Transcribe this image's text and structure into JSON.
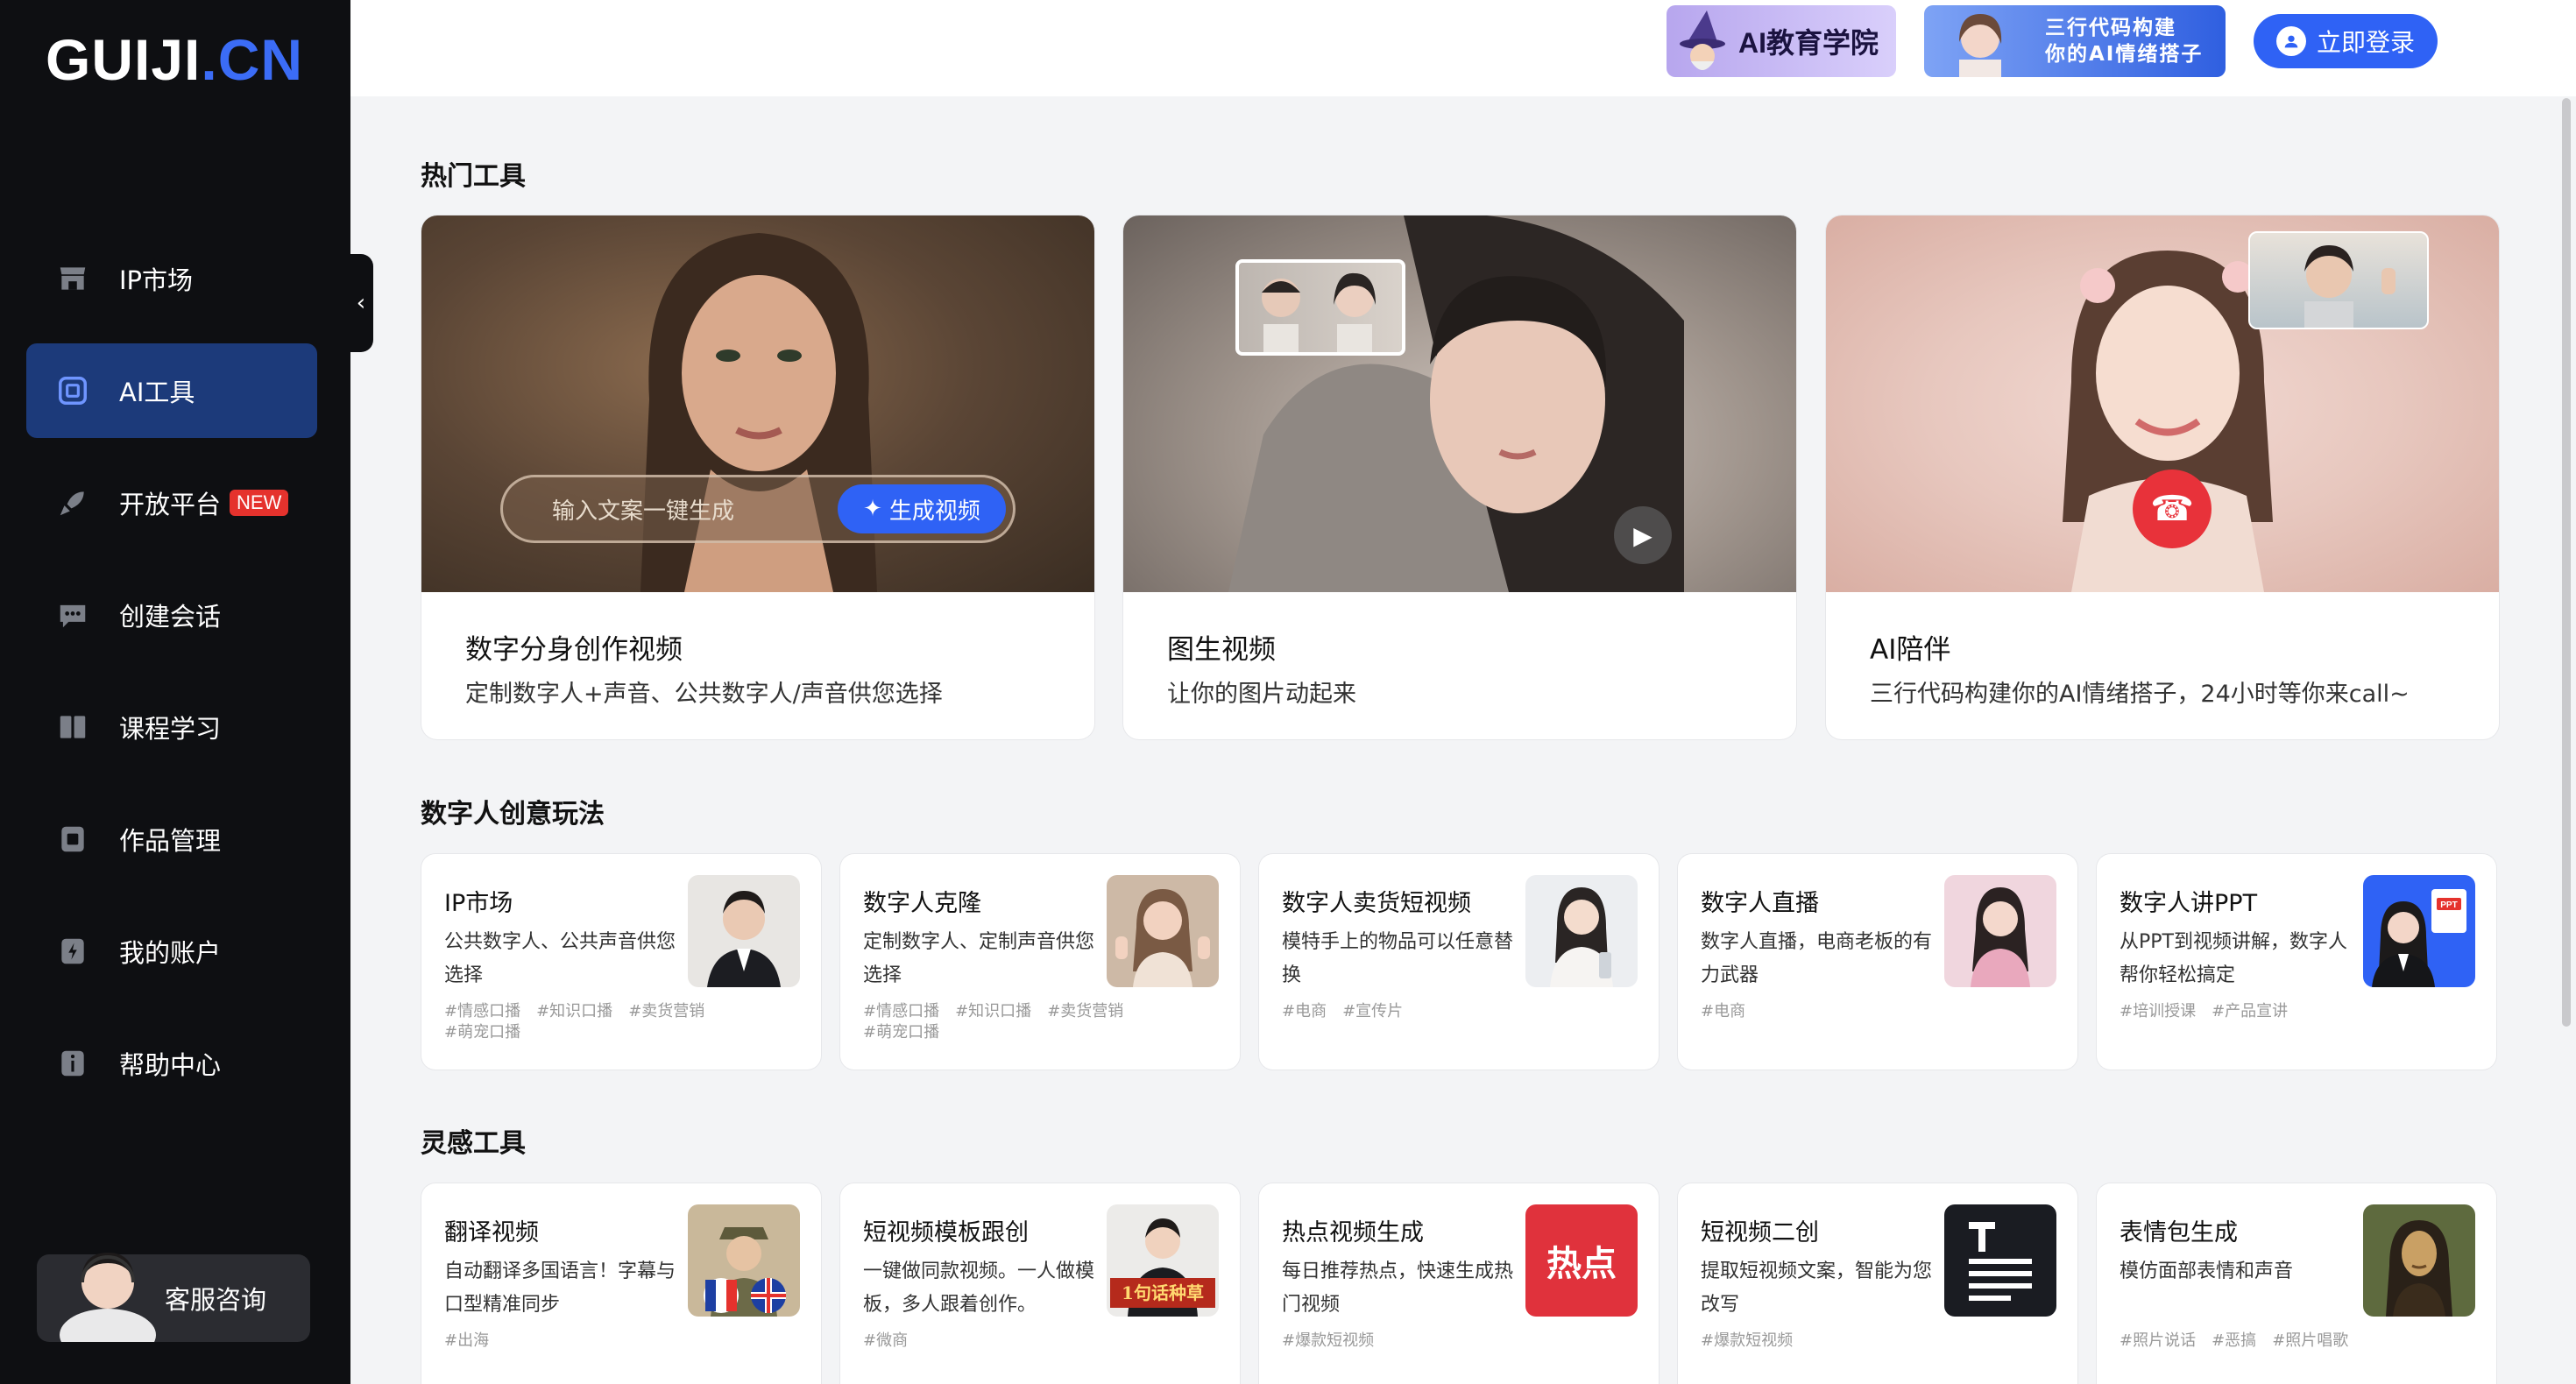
{
  "logo": {
    "main": "GUIJI",
    "dot_cn": ".CN"
  },
  "sidebar": {
    "items": [
      {
        "label": "IP市场",
        "icon": "store-icon"
      },
      {
        "label": "AI工具",
        "icon": "ai-tools-icon",
        "active": true
      },
      {
        "label": "开放平台",
        "icon": "rocket-icon",
        "badge": "NEW"
      },
      {
        "label": "创建会话",
        "icon": "chat-icon"
      },
      {
        "label": "课程学习",
        "icon": "course-icon"
      },
      {
        "label": "作品管理",
        "icon": "works-icon"
      },
      {
        "label": "我的账户",
        "icon": "account-icon"
      },
      {
        "label": "帮助中心",
        "icon": "help-icon"
      }
    ],
    "support_label": "客服咨询",
    "collapse_glyph": "‹"
  },
  "header": {
    "promo1": "AI教育学院",
    "promo2_line1": "三行代码构建",
    "promo2_line2": "你的AI情绪搭子",
    "login_label": "立即登录"
  },
  "sections": {
    "hot_tools": "热门工具",
    "digital_human": "数字人创意玩法",
    "inspiration": "灵感工具"
  },
  "hot_cards": [
    {
      "title": "数字分身创作视频",
      "desc": "定制数字人+声音、公共数字人/声音供您选择",
      "input_placeholder": "输入文案一键生成",
      "button": "生成视频"
    },
    {
      "title": "图生视频",
      "desc": "让你的图片动起来"
    },
    {
      "title": "AI陪伴",
      "desc": "三行代码构建你的AI情绪搭子，24小时等你来call~"
    }
  ],
  "digital_cards": [
    {
      "title": "IP市场",
      "desc": "公共数字人、公共声音供您选择",
      "tags": [
        "#情感口播",
        "#知识口播",
        "#卖货营销",
        "#萌宠口播"
      ]
    },
    {
      "title": "数字人克隆",
      "desc": "定制数字人、定制声音供您选择",
      "tags": [
        "#情感口播",
        "#知识口播",
        "#卖货营销",
        "#萌宠口播"
      ]
    },
    {
      "title": "数字人卖货短视频",
      "desc": "模特手上的物品可以任意替换",
      "tags": [
        "#电商",
        "#宣传片"
      ]
    },
    {
      "title": "数字人直播",
      "desc": "数字人直播，电商老板的有力武器",
      "tags": [
        "#电商"
      ]
    },
    {
      "title": "数字人讲PPT",
      "desc": "从PPT到视频讲解，数字人帮你轻松搞定",
      "tags": [
        "#培训授课",
        "#产品宣讲"
      ],
      "thumb_badge": "PPT"
    }
  ],
  "inspiration_cards": [
    {
      "title": "翻译视频",
      "desc": "自动翻译多国语言！字幕与口型精准同步",
      "tags": [
        "#出海"
      ]
    },
    {
      "title": "短视频模板跟创",
      "desc": "一键做同款视频。一人做模板，多人跟着创作。",
      "tags": [
        "#微商"
      ],
      "thumb_text": "1句话种草"
    },
    {
      "title": "热点视频生成",
      "desc": "每日推荐热点，快速生成热门视频",
      "tags": [
        "#爆款短视频"
      ],
      "thumb_text": "热点"
    },
    {
      "title": "短视频二创",
      "desc": "提取短视频文案，智能为您改写",
      "tags": [
        "#爆款短视频"
      ]
    },
    {
      "title": "表情包生成",
      "desc": "模仿面部表情和声音",
      "tags": [
        "#照片说话",
        "#恶搞",
        "#照片唱歌"
      ]
    }
  ],
  "colors": {
    "sidebar_bg": "#0e0f12",
    "accent": "#2f62f5",
    "active_nav": "#1c3a7a",
    "new_badge": "#e5322d",
    "hot_red": "#e0323c"
  }
}
